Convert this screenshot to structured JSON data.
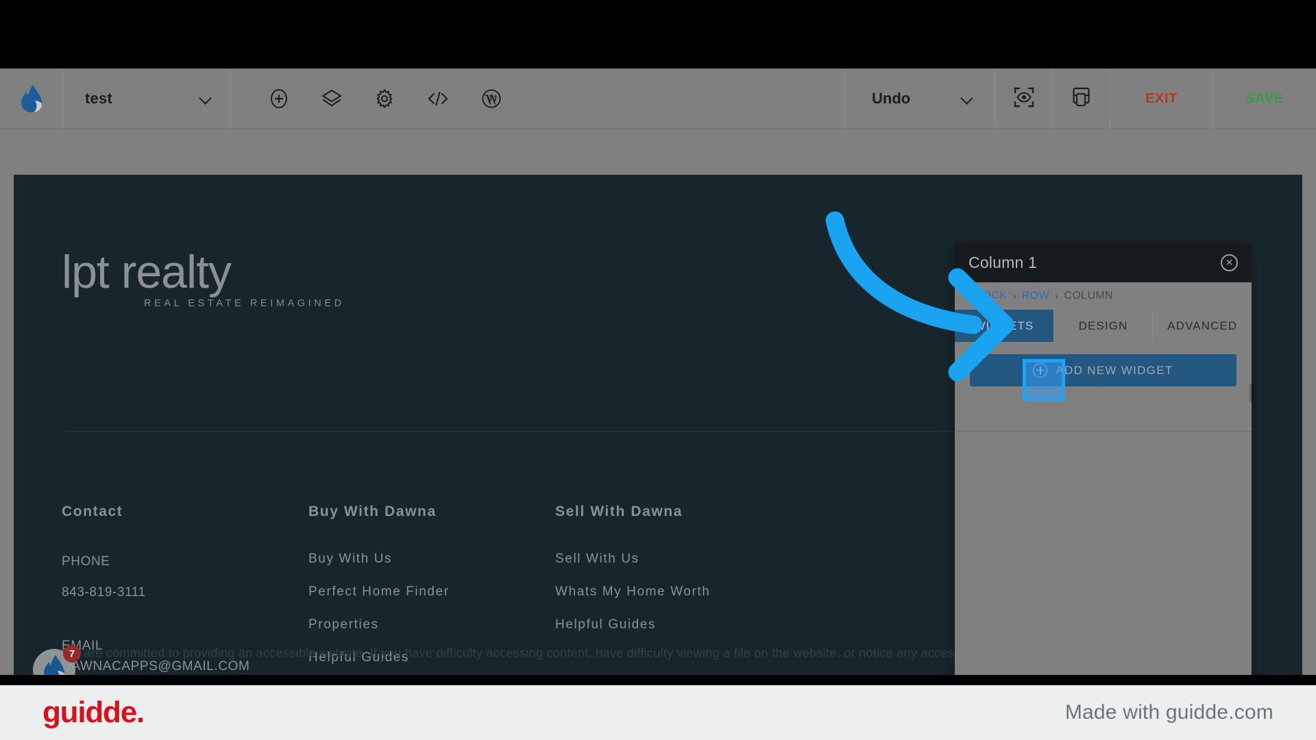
{
  "toolbar": {
    "brand_icon": "brizy-flame-logo-icon",
    "page_name": "test",
    "page_dropdown_icon": "chevron-down-icon",
    "icons": [
      {
        "name": "add-circle-icon",
        "label": "Add"
      },
      {
        "name": "layers-icon",
        "label": "Layers"
      },
      {
        "name": "gear-icon",
        "label": "Settings"
      },
      {
        "name": "code-icon",
        "label": "Code"
      },
      {
        "name": "wordpress-icon",
        "label": "WordPress"
      }
    ],
    "undo_label": "Undo",
    "undo_dropdown_icon": "chevron-down-icon",
    "preview_icon": "eye-preview-icon",
    "layout_icon": "layout-panel-icon",
    "exit_label": "EXIT",
    "save_label": "SAVE",
    "exit_color": "#b33a2b",
    "save_color": "#3f9a45"
  },
  "canvas": {
    "background": "#17262d",
    "brand": {
      "wordmark": "lpt realty",
      "tagline": "REAL ESTATE REIMAGINED"
    },
    "columns": [
      {
        "heading": "Contact",
        "fields": [
          {
            "label": "PHONE",
            "value": "843-819-3111"
          },
          {
            "label": "EMAIL",
            "value": "DAWNACAPPS@GMAIL.COM"
          }
        ]
      },
      {
        "heading": "Buy With Dawna",
        "links": [
          "Buy With Us",
          "Perfect Home Finder",
          "Properties",
          "Helpful Guides"
        ]
      },
      {
        "heading": "Sell With Dawna",
        "links": [
          "Sell With Us",
          "Whats My Home Worth",
          "Helpful Guides"
        ]
      }
    ],
    "accessibility_text": "We are committed to providing an accessible website. If you have difficulty accessing content, have difficulty viewing a file on the website, or notice any accessibility problems, pl",
    "chat_widget": {
      "icon": "flame-chat-icon",
      "badge_count": "7",
      "badge_color": "#9e2a2a"
    }
  },
  "panel": {
    "title": "Column 1",
    "close_icon": "close-circle-icon",
    "breadcrumb": [
      {
        "label": "BLOCK",
        "active": true
      },
      {
        "label": "ROW",
        "active": true
      },
      {
        "label": "COLUMN",
        "active": false
      }
    ],
    "breadcrumb_separator": "›",
    "tabs": [
      {
        "label": "WIDGETS",
        "selected": true
      },
      {
        "label": "DESIGN",
        "selected": false
      },
      {
        "label": "ADVANCED",
        "selected": false
      }
    ],
    "add_widget": {
      "label": "ADD NEW WIDGET",
      "icon": "plus-circle-icon",
      "color": "#24577f"
    },
    "resize_handle_icon": "drag-handle-icon"
  },
  "overlay": {
    "arrow_color": "#1aa3f0",
    "highlight_color": "#22a2f2",
    "highlight_target": "add-new-widget-plus-icon"
  },
  "footer_bar": {
    "logo_text": "guidde.",
    "logo_color": "#d6111c",
    "made_with_text": "Made with guidde.com"
  }
}
